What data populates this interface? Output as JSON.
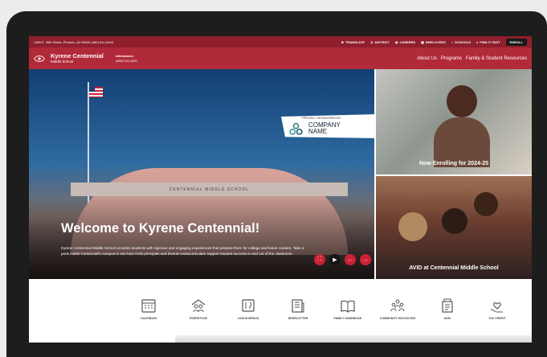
{
  "topbar": {
    "address": "1369 E. 36th Street, Phoenix, AZ 85040  (480) 541-6400",
    "links": [
      {
        "label": "TRANSLATE",
        "icon": "translate-icon"
      },
      {
        "label": "DISTRICT",
        "icon": "district-icon"
      },
      {
        "label": "CAREERS",
        "icon": "careers-icon"
      },
      {
        "label": "EMPLOYEES",
        "icon": "employees-icon"
      },
      {
        "label": "SCHOOLS",
        "icon": "schools-icon"
      },
      {
        "label": "FIND IT FAST",
        "icon": "search-icon"
      }
    ],
    "enroll": "ENROLL"
  },
  "header": {
    "school_name": "Kyrene Centennial",
    "school_sub": "Middle School",
    "attendance_title": "Attendance:",
    "attendance_phone": "(480) 541-6401",
    "nav": [
      "About Us",
      "Programs",
      "Family & Student Resources"
    ]
  },
  "hero": {
    "building_text": "CENTENNIAL MIDDLE SCHOOL",
    "title": "Welcome to Kyrene Centennial!",
    "description": "Kyrene Centennial Middle School provides students with rigorous and engaging experiences that prepare them for college and future careers. Take a peek inside Centennial's campus to see how AVID principles and diverse extracurriculars support student success in and out of the classroom.",
    "controls": {
      "expand": "⛶",
      "play": "▶",
      "prev": "←",
      "next": "→"
    },
    "sponsor": {
      "label": "PROUDLY SPONSORED BY:",
      "company": "COMPANY NAME"
    }
  },
  "panels": {
    "enroll_caption": "Now Enrolling for 2024-25",
    "avid_caption": "AVID at Centennial Middle School"
  },
  "quicklinks": [
    {
      "label": "CALENDAR",
      "icon": "calendar-icon"
    },
    {
      "label": "PARENTVUE",
      "icon": "parentvue-icon"
    },
    {
      "label": "LUNCH MENUS",
      "icon": "lunch-menu-icon"
    },
    {
      "label": "NEWSLETTER",
      "icon": "newsletter-icon"
    },
    {
      "label": "FAMILY HANDBOOK",
      "icon": "handbook-icon"
    },
    {
      "label": "COMMUNITY EDUCATION",
      "icon": "community-icon"
    },
    {
      "label": "AVID",
      "icon": "avid-icon"
    },
    {
      "label": "TAX CREDIT",
      "icon": "tax-credit-icon"
    }
  ],
  "colors": {
    "topbar": "#8f1f2b",
    "header": "#b12a3a",
    "accent": "#cc2234"
  }
}
